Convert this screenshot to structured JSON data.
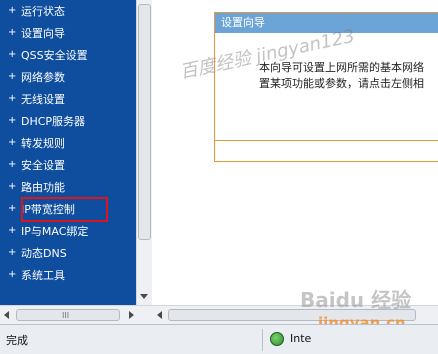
{
  "nav": {
    "items": [
      {
        "label": "运行状态"
      },
      {
        "label": "设置向导"
      },
      {
        "label": "QSS安全设置"
      },
      {
        "label": "网络参数"
      },
      {
        "label": "无线设置"
      },
      {
        "label": "DHCP服务器"
      },
      {
        "label": "转发规则"
      },
      {
        "label": "安全设置"
      },
      {
        "label": "路由功能"
      },
      {
        "label": "IP带宽控制",
        "highlighted": true
      },
      {
        "label": "IP与MAC绑定"
      },
      {
        "label": "动态DNS"
      },
      {
        "label": "系统工具"
      }
    ],
    "bullet": "+"
  },
  "scrollbar": {
    "grip": "III"
  },
  "wizard": {
    "title": "设置向导",
    "line1": "本向导可设置上网所需的基本网络",
    "line2": "置某项功能或参数，请点击左侧相"
  },
  "status": {
    "text": "完成",
    "zone": "Inte"
  },
  "watermarks": {
    "top": "百度经验 jingyan123",
    "baidu": "Baidu 经验",
    "site": "jingyan.cn"
  },
  "colors": {
    "nav_bg": "#0f4d9f",
    "highlight_border": "#e0141b",
    "wizard_header": "#6da4d8",
    "wizard_border": "#e49a39"
  }
}
